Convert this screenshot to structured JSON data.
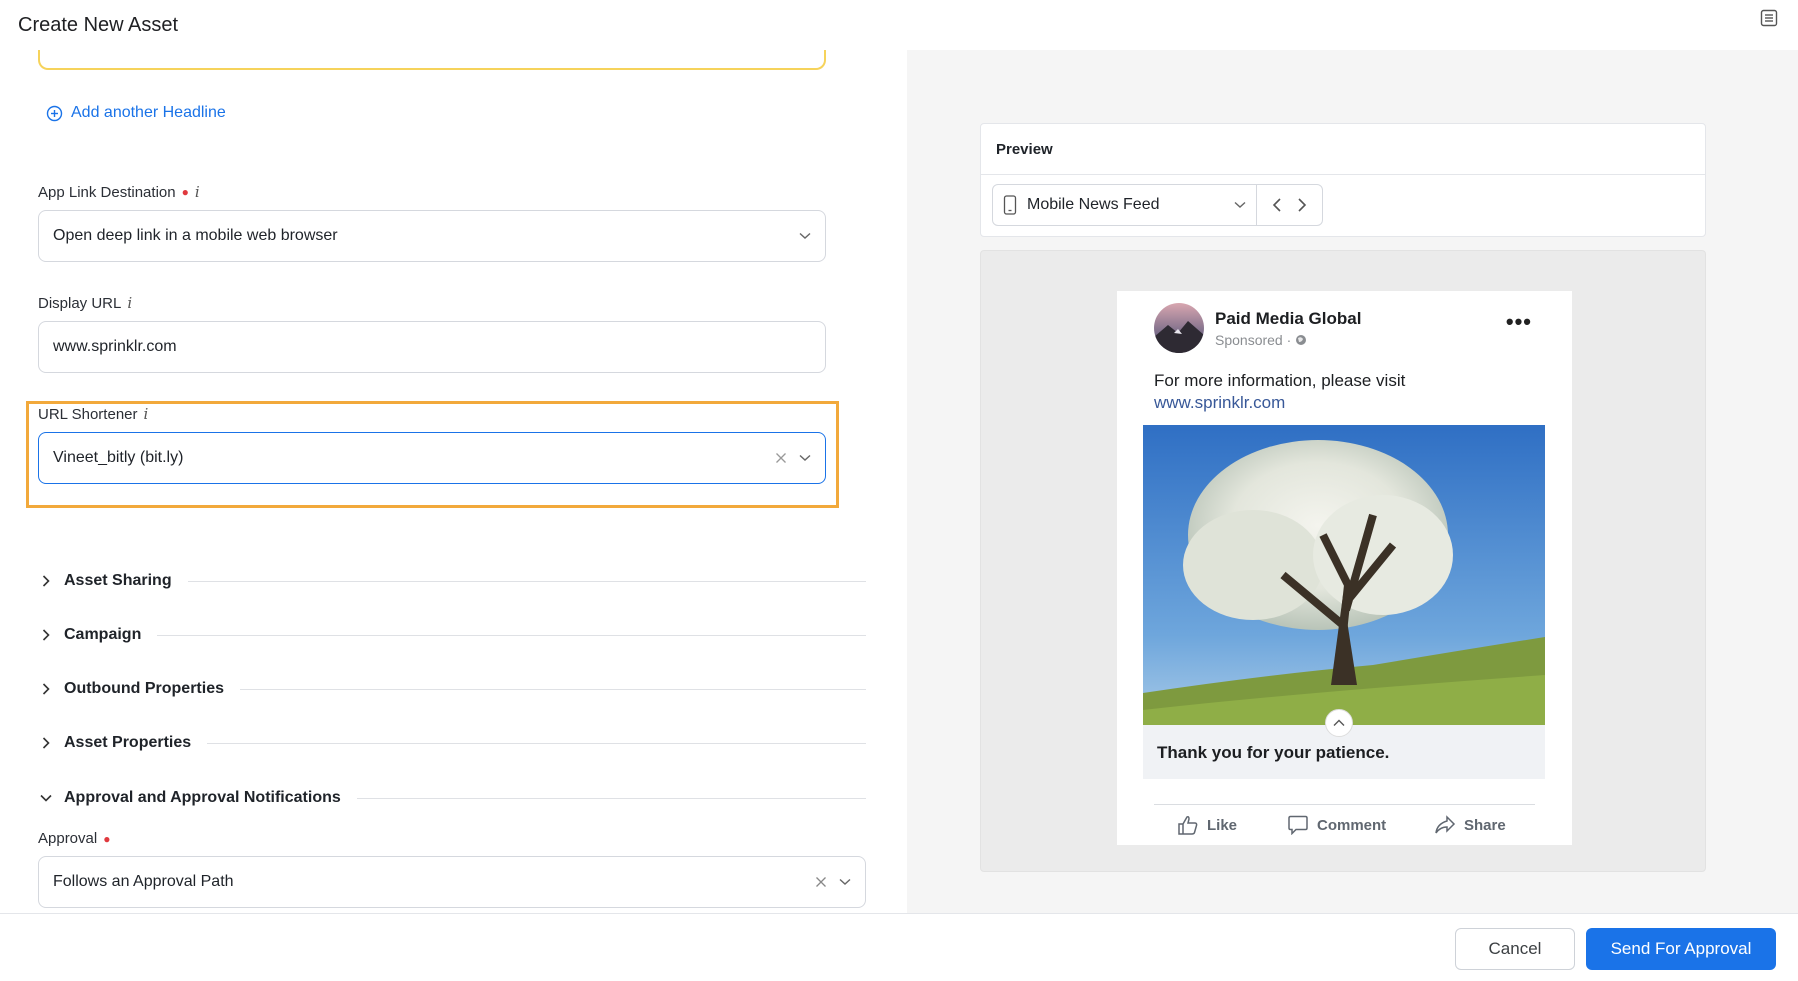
{
  "header": {
    "title": "Create New Asset",
    "menu_icon": "list-icon"
  },
  "form": {
    "add_headline_label": "Add another Headline",
    "app_link_destination": {
      "label": "App Link Destination",
      "required": true,
      "value": "Open deep link in a mobile web browser"
    },
    "display_url": {
      "label": "Display URL",
      "value": "www.sprinklr.com"
    },
    "url_shortener": {
      "label": "URL Shortener",
      "value": "Vineet_bitly (bit.ly)"
    },
    "sections": [
      {
        "label": "Asset Sharing",
        "expanded": false
      },
      {
        "label": "Campaign",
        "expanded": false
      },
      {
        "label": "Outbound Properties",
        "expanded": false
      },
      {
        "label": "Asset Properties",
        "expanded": false
      },
      {
        "label": "Approval and Approval Notifications",
        "expanded": true
      }
    ],
    "approval": {
      "label": "Approval",
      "required": true,
      "value": "Follows an Approval Path"
    }
  },
  "preview": {
    "title": "Preview",
    "placement": "Mobile News Feed",
    "post": {
      "page_name": "Paid Media Global",
      "sponsored": "Sponsored ·",
      "body_text": "For more information, please visit",
      "body_link": "www.sprinklr.com",
      "caption": "Thank you for your patience.",
      "actions": {
        "like": "Like",
        "comment": "Comment",
        "share": "Share"
      }
    }
  },
  "footer": {
    "cancel_label": "Cancel",
    "send_label": "Send For Approval"
  },
  "colors": {
    "accent": "#1a73e8",
    "highlight": "#f2a93b",
    "required": "#e0393e"
  }
}
